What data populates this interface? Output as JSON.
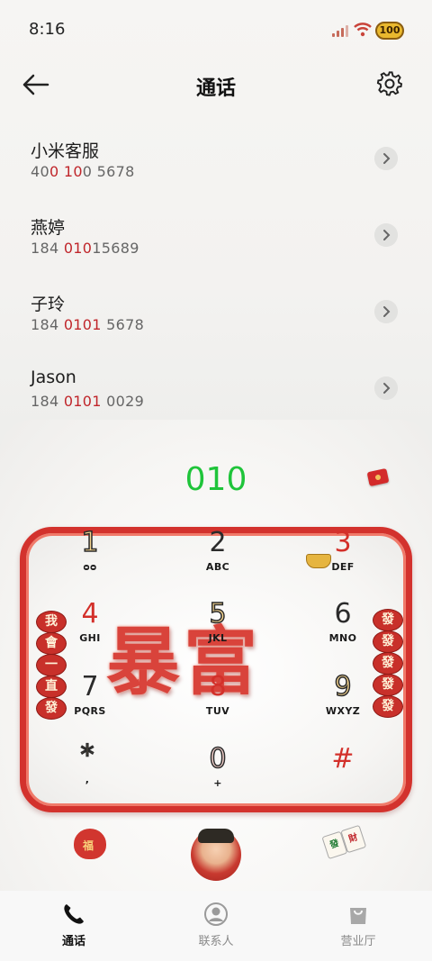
{
  "status": {
    "time": "8:16",
    "battery": "100"
  },
  "header": {
    "title": "通话"
  },
  "contacts": [
    {
      "name": "小米客服",
      "num_parts": [
        "40",
        "0 10",
        "0 5678"
      ]
    },
    {
      "name": "燕婷",
      "num_parts": [
        "184 ",
        "010",
        "15689"
      ]
    },
    {
      "name": "子玲",
      "num_parts": [
        "184 ",
        "0101",
        " 5678"
      ]
    },
    {
      "name": "Jason",
      "num_parts": [
        "184 ",
        "0101",
        " 0029"
      ]
    }
  ],
  "dialer": {
    "input": "010",
    "big_text": "暴富",
    "left_coins": [
      "我",
      "會",
      "一",
      "直",
      "發"
    ],
    "right_coins": [
      "發",
      "發",
      "發",
      "發",
      "發"
    ],
    "keys": [
      {
        "digit": "1",
        "letters": "ᴑᴑ"
      },
      {
        "digit": "2",
        "letters": "ABC"
      },
      {
        "digit": "3",
        "letters": "DEF"
      },
      {
        "digit": "4",
        "letters": "GHI"
      },
      {
        "digit": "5",
        "letters": "JKL"
      },
      {
        "digit": "6",
        "letters": "MNO"
      },
      {
        "digit": "7",
        "letters": "PQRS"
      },
      {
        "digit": "8",
        "letters": "TUV"
      },
      {
        "digit": "9",
        "letters": "WXYZ"
      },
      {
        "digit": "*",
        "letters": ","
      },
      {
        "digit": "0",
        "letters": "+"
      },
      {
        "digit": "#",
        "letters": ""
      }
    ]
  },
  "decor": {
    "bag_char": "福",
    "mahjong": [
      "發",
      "財"
    ]
  },
  "nav": {
    "tabs": [
      {
        "label": "通话",
        "icon": "phone-icon"
      },
      {
        "label": "联系人",
        "icon": "person-icon"
      },
      {
        "label": "营业厅",
        "icon": "shopping-bag-icon"
      }
    ]
  },
  "colors": {
    "accent_red": "#d3302a",
    "dial_green": "#1fc43a"
  }
}
